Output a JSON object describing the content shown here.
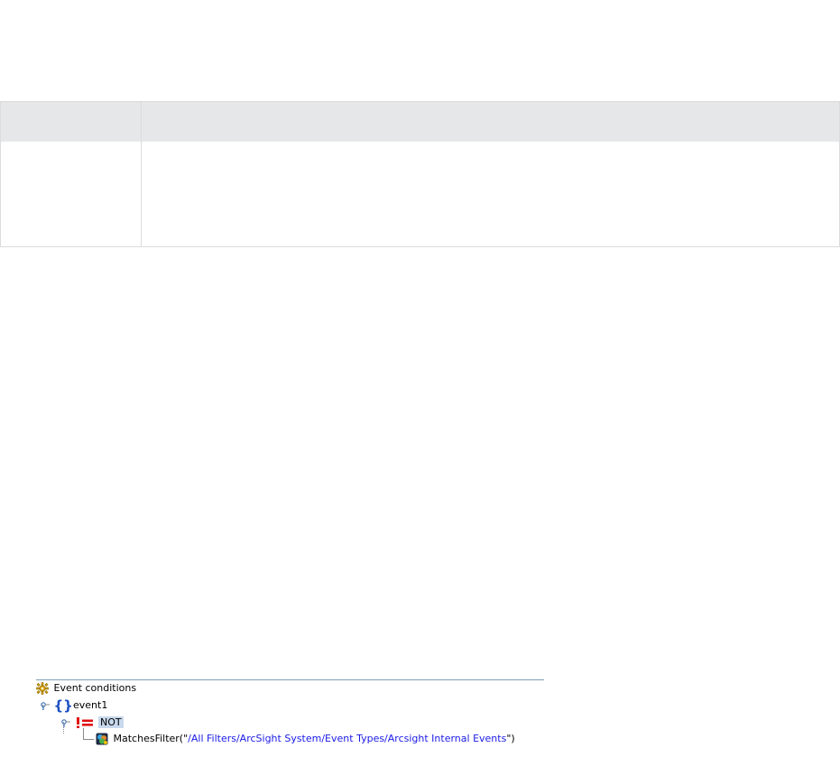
{
  "table": {
    "header": [
      "",
      ""
    ],
    "row": [
      "",
      ""
    ]
  },
  "tree": {
    "root_label": "Event conditions",
    "event_label": "event1",
    "operator_label": "NOT",
    "function_name": "MatchesFilter(\"",
    "function_arg": "/All Filters/ArcSight System/Event Types/Arcsight Internal Events",
    "function_close": "\")",
    "icons": {
      "root": "gear-icon",
      "event": "braces-icon",
      "operator": "not-equal-icon",
      "filter": "filter-icon"
    },
    "colors": {
      "braces": "#1b4fc2",
      "not": "#e01010",
      "argument": "#1a1ae6",
      "selection": "#c9d9ee"
    }
  }
}
